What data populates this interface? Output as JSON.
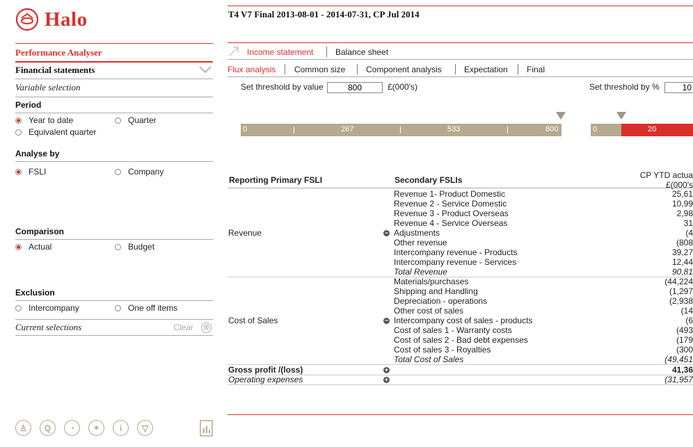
{
  "app": {
    "logo_text": "Halo"
  },
  "sidebar": {
    "module": "Performance Analyser",
    "section": "Financial statements",
    "variable_selection": "Variable selection",
    "period": {
      "title": "Period",
      "options": [
        "Year to date",
        "Quarter",
        "Equivalent quarter"
      ],
      "selected": "Year to date"
    },
    "analyse_by": {
      "title": "Analyse by",
      "options": [
        "FSLI",
        "Company"
      ],
      "selected": "FSLI"
    },
    "comparison": {
      "title": "Comparison",
      "options": [
        "Actual",
        "Budget"
      ],
      "selected": "Actual"
    },
    "exclusion": {
      "title": "Exclusion",
      "options": [
        "Intercompany",
        "One off items"
      ]
    },
    "current_selections": "Current selections",
    "clear_label": "Clear",
    "clear_icon": "⊗",
    "tool_icons": [
      "user-icon",
      "search-icon",
      "speedometer-icon",
      "target-icon",
      "info-icon",
      "filter-down-icon"
    ],
    "tool_glyphs": [
      "♙",
      "Q",
      "◔",
      "⌖",
      "i",
      "▽"
    ]
  },
  "main": {
    "title": "T4 V7 Final 2013-08-01 - 2014-07-31, CP Jul 2014",
    "primary_tabs": [
      "Income statement",
      "Balance sheet"
    ],
    "primary_active": "Income statement",
    "secondary_tabs": [
      "Flux analysis",
      "Common size",
      "Component analysis",
      "Expectation",
      "Final"
    ],
    "secondary_active": "Flux analysis",
    "threshold_value": {
      "label": "Set threshold by value",
      "value": "800",
      "unit": "£(000's)"
    },
    "threshold_pct": {
      "label": "Set threshold by %",
      "value": "10"
    },
    "value_slider": {
      "labels": [
        "0",
        "267",
        "533",
        "800"
      ],
      "value": 800,
      "max": 800
    },
    "pct_slider": {
      "labels": [
        "0",
        "20"
      ],
      "value": 10
    }
  },
  "table": {
    "col_primary": "Reporting Primary FSLI",
    "col_secondary": "Secondary FSLIs",
    "col_value_line1": "CP YTD actua",
    "col_value_line2": "£(000's",
    "groups": [
      {
        "label": "Revenue",
        "icon": "⊖",
        "rows": [
          {
            "name": "Revenue 1-  Product Domestic",
            "value": "25,61"
          },
          {
            "name": "Revenue 2 - Service Domestic",
            "value": "10,99"
          },
          {
            "name": "Revenue 3 - Product Overseas",
            "value": "2,98"
          },
          {
            "name": "Revenue 4 - Service Overseas",
            "value": "31"
          },
          {
            "name": "Adjustments",
            "value": "(4"
          },
          {
            "name": "Other revenue",
            "value": "(808"
          },
          {
            "name": "Intercompany revenue - Products",
            "value": "39,27"
          },
          {
            "name": "Intercompany revenue - Services",
            "value": "12,44"
          },
          {
            "name": "Total Revenue",
            "value": "90,81"
          }
        ]
      },
      {
        "label": "Cost of Sales",
        "icon": "⊖",
        "rows": [
          {
            "name": "Materials/purchases",
            "value": "(44,224"
          },
          {
            "name": "Shipping and Handling",
            "value": "(1,297"
          },
          {
            "name": "Depreciation - operations",
            "value": "(2,938"
          },
          {
            "name": "Other cost of sales",
            "value": "(14"
          },
          {
            "name": "Intercompany cost of sales - products",
            "value": "(6"
          },
          {
            "name": "Cost of sales 1 - Warranty costs",
            "value": "(493"
          },
          {
            "name": "Cost of sales 2 - Bad debt expenses",
            "value": "(179"
          },
          {
            "name": "Cost of sales 3 - Royalties",
            "value": "(300"
          },
          {
            "name": "Total Cost of Sales",
            "value": "(49,451"
          }
        ]
      }
    ],
    "summary_rows": [
      {
        "label": "Gross profit /(loss)",
        "value": "41,36",
        "icon": "⊕"
      },
      {
        "label": "Operating expenses",
        "value": "(31,957",
        "icon": "⊕"
      }
    ]
  },
  "colors": {
    "accent": "#d9302b",
    "slider": "#b5a98f",
    "handle": "#a09683"
  }
}
